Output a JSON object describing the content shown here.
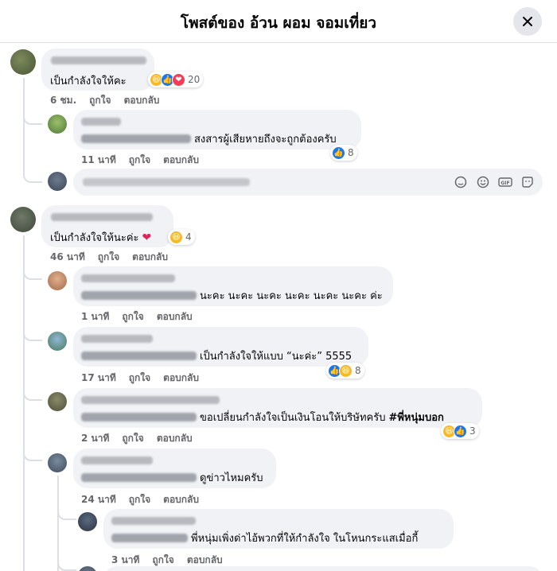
{
  "header": {
    "title": "โพสต์ของ อ้วน ผอม จอมเที่ยว"
  },
  "comments": [
    {
      "text": "เป็นกำลังใจให้คะ",
      "time": "6 ชม.",
      "like_label": "ถูกใจ",
      "reply_label": "ตอบกลับ",
      "reactions": [
        "haha",
        "like",
        "love"
      ],
      "reaction_count": "20",
      "replies": [
        {
          "text": "สงสารผู้เสียหายถึงจะถูกต้องครับ",
          "time": "11 นาที",
          "like_label": "ถูกใจ",
          "reply_label": "ตอบกลับ",
          "reactions": [
            "like"
          ],
          "reaction_count": "8"
        }
      ]
    },
    {
      "text": "เป็นกำลังใจให้นะค่ะ",
      "time": "46 นาที",
      "like_label": "ถูกใจ",
      "reply_label": "ตอบกลับ",
      "reactions": [
        "haha"
      ],
      "reaction_count": "4",
      "replies": [
        {
          "text": "นะคะ นะคะ นะคะ นะคะ นะคะ นะคะ ค่ะ",
          "time": "1 นาที",
          "like_label": "ถูกใจ",
          "reply_label": "ตอบกลับ"
        },
        {
          "text": "เป็นกำลังใจให้แบบ “นะค่ะ” 5555",
          "time": "17 นาที",
          "like_label": "ถูกใจ",
          "reply_label": "ตอบกลับ",
          "reactions": [
            "like",
            "haha"
          ],
          "reaction_count": "8"
        },
        {
          "text": "ขอเปลี่ยนกำลังใจเป็นเงินโอนให้บริษัทครับ",
          "hashtag": "#พี่หนุ่มบอก",
          "time": "2 นาที",
          "like_label": "ถูกใจ",
          "reply_label": "ตอบกลับ",
          "reactions": [
            "haha",
            "like"
          ],
          "reaction_count": "3"
        },
        {
          "text": "ดูข่าวไหมครับ",
          "time": "24 นาที",
          "like_label": "ถูกใจ",
          "reply_label": "ตอบกลับ"
        },
        {
          "text": "พี่หนุ่มเพิ่งด่าไอ้พวกที่ให้กำลังใจ ในโหนกระแสเมื่อกี้",
          "time": "3 นาที",
          "like_label": "ถูกใจ",
          "reply_label": "ตอบกลับ"
        }
      ]
    }
  ],
  "reply_input": {
    "placeholder": ""
  },
  "input_icons": [
    "sticker-icon",
    "emoji-icon",
    "gif-icon",
    "avatar-sticker-icon"
  ],
  "colors": {
    "like": "#1877f2",
    "haha": "#f7b928",
    "love": "#f33e58",
    "bubble": "#f0f2f5",
    "meta": "#65676b"
  }
}
